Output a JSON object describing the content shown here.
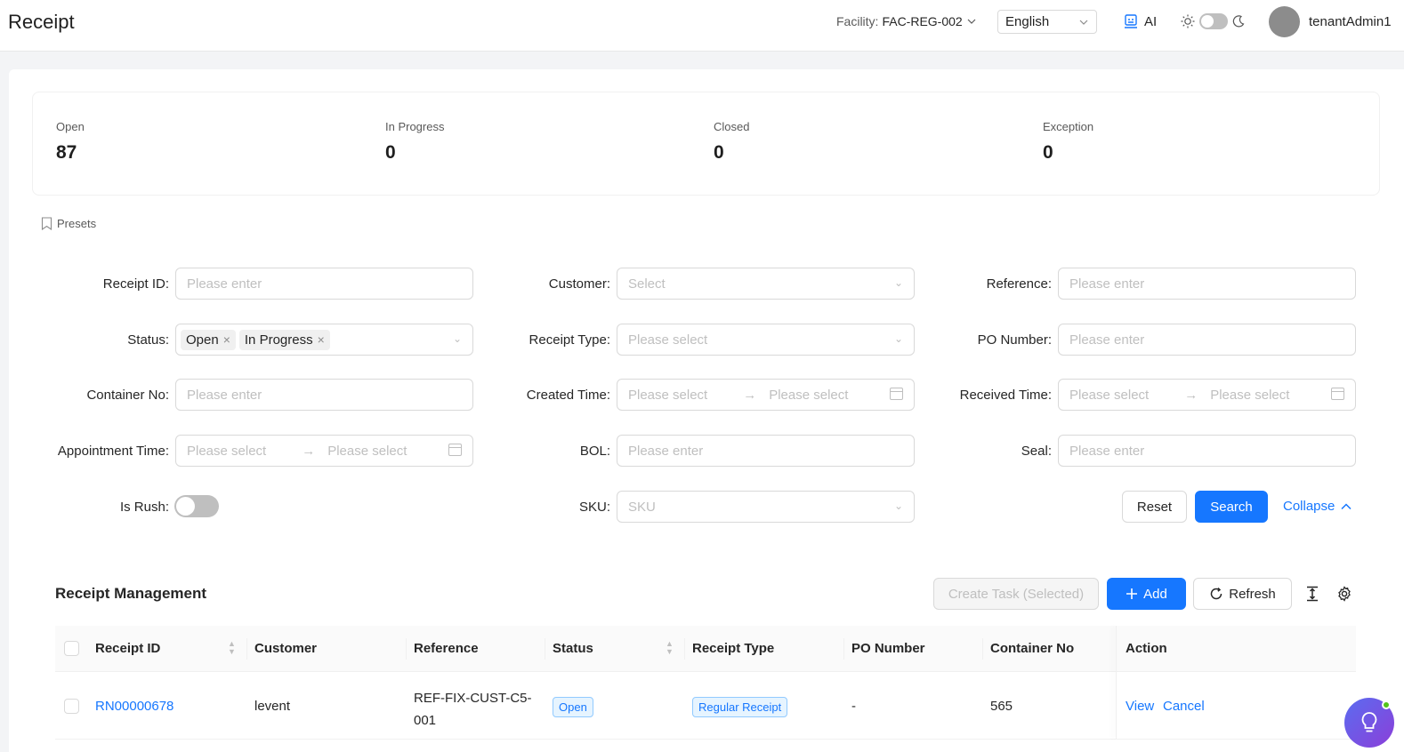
{
  "header": {
    "title": "Receipt",
    "facility_label": "Facility:",
    "facility_value": "FAC-REG-002",
    "language": "English",
    "ai_label": "AI",
    "username": "tenantAdmin1"
  },
  "stats": [
    {
      "label": "Open",
      "value": "87"
    },
    {
      "label": "In Progress",
      "value": "0"
    },
    {
      "label": "Closed",
      "value": "0"
    },
    {
      "label": "Exception",
      "value": "0"
    }
  ],
  "presets_label": "Presets",
  "filters": {
    "receipt_id": {
      "label": "Receipt ID",
      "placeholder": "Please enter"
    },
    "customer": {
      "label": "Customer",
      "placeholder": "Select"
    },
    "reference": {
      "label": "Reference",
      "placeholder": "Please enter"
    },
    "status": {
      "label": "Status",
      "tags": [
        "Open",
        "In Progress"
      ]
    },
    "receipt_type": {
      "label": "Receipt Type",
      "placeholder": "Please select"
    },
    "po_number": {
      "label": "PO Number",
      "placeholder": "Please enter"
    },
    "container_no": {
      "label": "Container No",
      "placeholder": "Please enter"
    },
    "created_time": {
      "label": "Created Time",
      "start": "Please select",
      "end": "Please select"
    },
    "received_time": {
      "label": "Received Time",
      "start": "Please select",
      "end": "Please select"
    },
    "appointment_time": {
      "label": "Appointment Time",
      "start": "Please select",
      "end": "Please select"
    },
    "bol": {
      "label": "BOL",
      "placeholder": "Please enter"
    },
    "seal": {
      "label": "Seal",
      "placeholder": "Please enter"
    },
    "is_rush": {
      "label": "Is Rush"
    },
    "sku": {
      "label": "SKU",
      "placeholder": "SKU"
    }
  },
  "filter_actions": {
    "reset": "Reset",
    "search": "Search",
    "collapse": "Collapse"
  },
  "table_section": {
    "title": "Receipt Management",
    "create_task": "Create Task (Selected)",
    "add": "Add",
    "refresh": "Refresh"
  },
  "columns": [
    "Receipt ID",
    "Customer",
    "Reference",
    "Status",
    "Receipt Type",
    "PO Number",
    "Container No",
    "Action"
  ],
  "rows": [
    {
      "receipt_id": "RN00000678",
      "customer": "levent",
      "reference_line1": "REF-FIX-CUST-C5-",
      "reference_line2": "001",
      "status": "Open",
      "receipt_type": "Regular Receipt",
      "po_number": "-",
      "container_no": "565",
      "actions": [
        "View",
        "Cancel"
      ]
    }
  ],
  "colors": {
    "primary": "#1677ff",
    "badge_bg": "#e6f4ff",
    "fab_start": "#5b6cf0",
    "fab_end": "#8b3fd9"
  }
}
